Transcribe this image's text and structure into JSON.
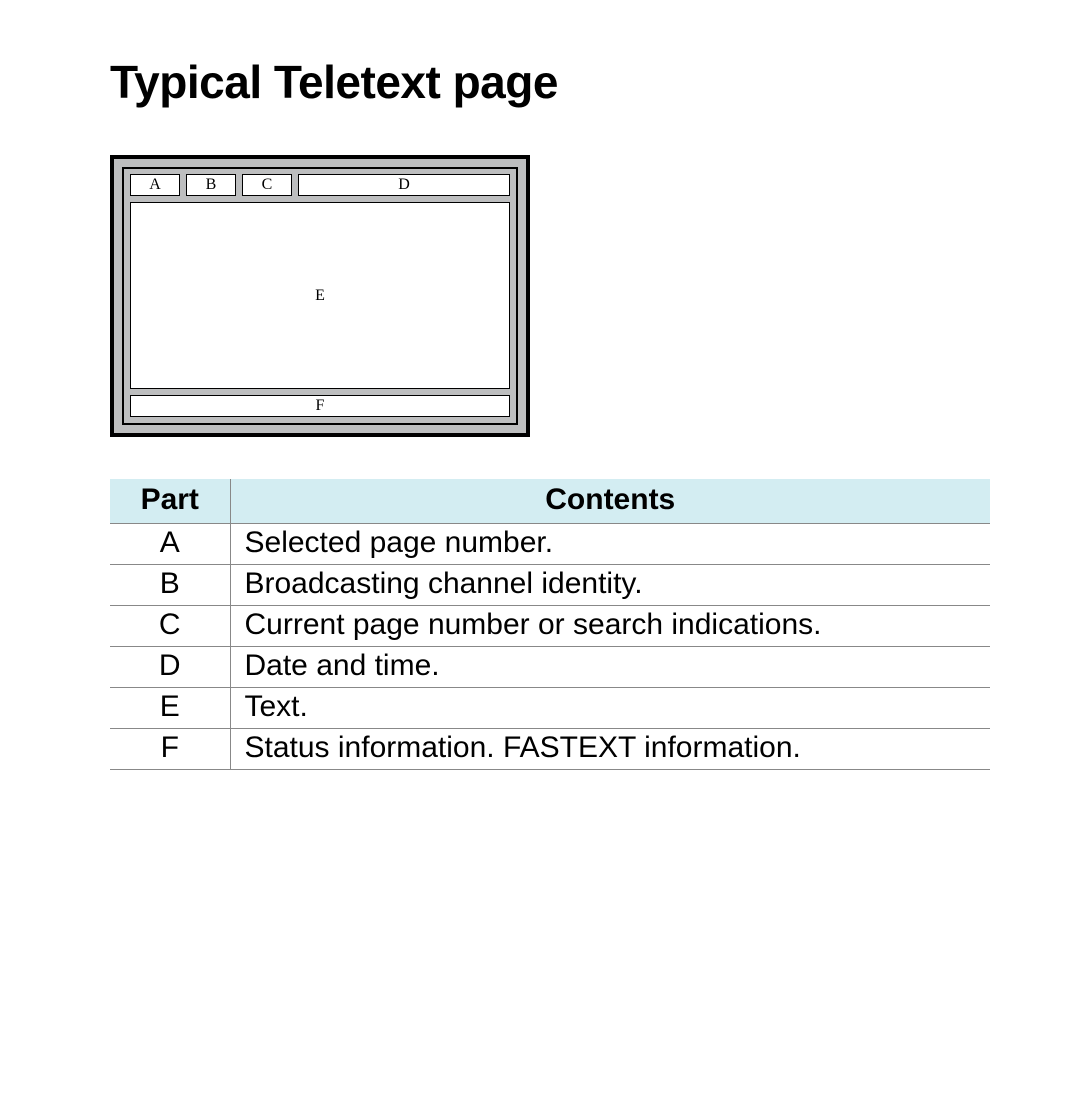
{
  "title": "Typical Teletext page",
  "diagram": {
    "a": "A",
    "b": "B",
    "c": "C",
    "d": "D",
    "e": "E",
    "f": "F"
  },
  "table": {
    "headers": {
      "part": "Part",
      "contents": "Contents"
    },
    "rows": [
      {
        "part": "A",
        "contents": "Selected page number."
      },
      {
        "part": "B",
        "contents": "Broadcasting channel identity."
      },
      {
        "part": "C",
        "contents": "Current page number or search indications."
      },
      {
        "part": "D",
        "contents": "Date and time."
      },
      {
        "part": "E",
        "contents": "Text."
      },
      {
        "part": "F",
        "contents": "Status information. FASTEXT information."
      }
    ]
  }
}
